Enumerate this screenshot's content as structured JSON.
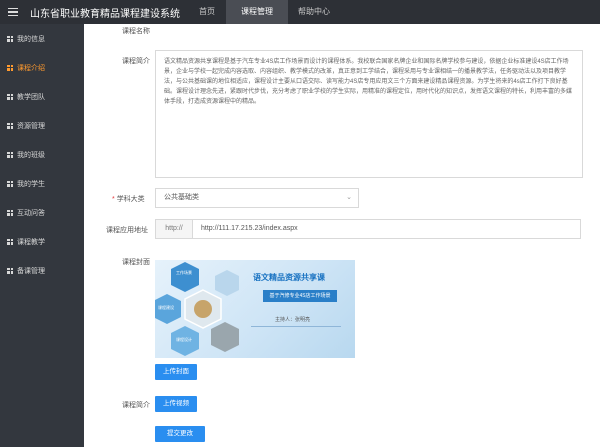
{
  "header": {
    "title": "山东省职业教育精品课程建设系统",
    "nav": [
      "首页",
      "课程管理",
      "帮助中心"
    ]
  },
  "sidebar": {
    "items": [
      {
        "label": "我的信息",
        "active": false
      },
      {
        "label": "课程介绍",
        "active": true
      },
      {
        "label": "教学团队",
        "active": false
      },
      {
        "label": "资源管理",
        "active": false
      },
      {
        "label": "我的班级",
        "active": false
      },
      {
        "label": "我的学生",
        "active": false
      },
      {
        "label": "互动问答",
        "active": false
      },
      {
        "label": "课程教学",
        "active": false
      },
      {
        "label": "备课管理",
        "active": false
      }
    ]
  },
  "form": {
    "name_label": "课程名称",
    "intro_label": "课程简介",
    "intro_text": "语文精品资源共享课程是基于汽车专业4S店工作场景而设计的课程体系。我校联合国家名牌企业和国际名牌学校参与建设，依据企业标准建设4S店工作场景，企业与学校一起完成内容选取、内容组织、教学模式的改革，真正意到工学结合，课程采用与专业课相结一的播景教学法，任务驱动法以及项目教学法，与公共基础课的地位相适应，课程设计主要从口语交际、读写能力4S店专用应用文三个方面来建设精品课程资源。为学生将来的4s店工作打下良好基础。课程设计理念先进，紧跟时代步伐，充分考虑了职业学校的学生实际，用精准的课程定位，用时代化的知识点，发挥语文课程的特长，利用丰富的多媒体手段，打造成资源课程中的精品。",
    "category_label": "学科大类",
    "category_required": "*",
    "category_value": "公共基础类",
    "url_label": "课程应用地址",
    "url_prefix": "http://",
    "url_value": "http://111.17.215.23/index.aspx",
    "cover_label": "课程封面",
    "cover": {
      "tiles": [
        "工作场景",
        "课程建设",
        "课程设计"
      ],
      "title": "语文精品资源共享课",
      "subtitle": "基于汽修专业4S店工作场景",
      "author": "主持人：张明亮"
    },
    "upload_cover": "上传封面",
    "video_label": "课程简介",
    "upload_video": "上传视频",
    "submit": "提交更改"
  }
}
